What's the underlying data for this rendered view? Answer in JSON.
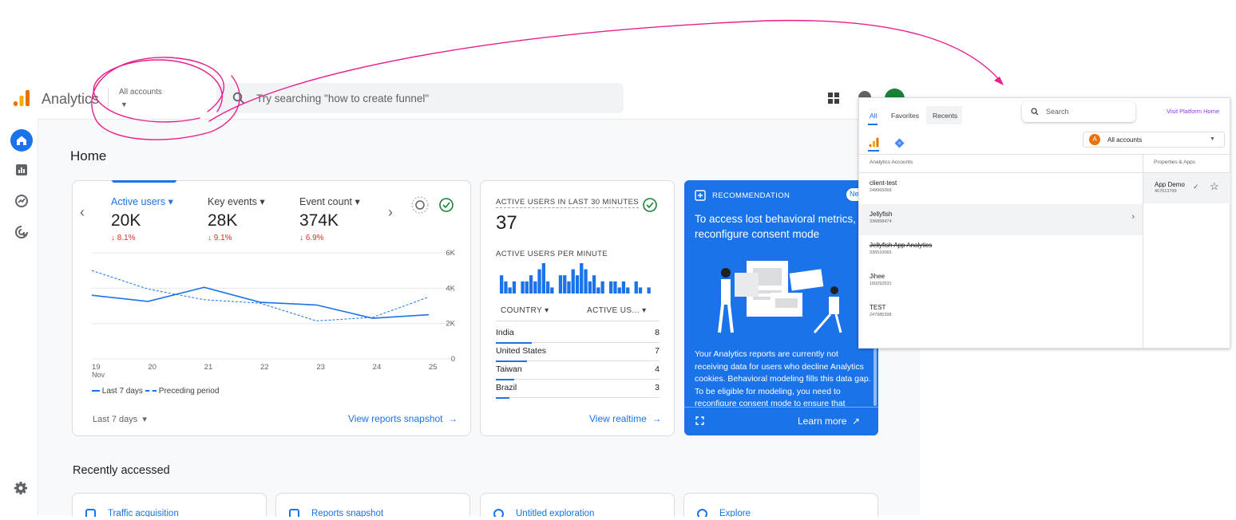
{
  "header": {
    "app_name": "Analytics",
    "account_selector": "All accounts",
    "search_placeholder": "Try searching \"how to create funnel\""
  },
  "home": {
    "title": "Home",
    "metrics": [
      {
        "label": "Active users",
        "value": "20K",
        "delta": "8.1%"
      },
      {
        "label": "Key events",
        "value": "28K",
        "delta": "9.1%"
      },
      {
        "label": "Event count",
        "value": "374K",
        "delta": "6.9%"
      }
    ],
    "chart_data": {
      "type": "line",
      "x": [
        "19",
        "20",
        "21",
        "22",
        "23",
        "24",
        "25"
      ],
      "x_sublabel": "Nov",
      "y_ticks": [
        "6K",
        "4K",
        "2K",
        "0"
      ],
      "ylim": [
        0,
        6000
      ],
      "series": [
        {
          "name": "Last 7 days",
          "values": [
            3600,
            3250,
            4050,
            3200,
            3050,
            2300,
            2500
          ]
        },
        {
          "name": "Preceding period",
          "values": [
            5000,
            3950,
            3350,
            3150,
            2150,
            2350,
            3500
          ]
        }
      ],
      "legend": "bottom-left",
      "grid": true
    },
    "date_range": "Last 7 days",
    "view_snapshot": "View reports snapshot"
  },
  "realtime": {
    "title": "ACTIVE USERS IN LAST 30 MINUTES",
    "value": "37",
    "per_minute_label": "ACTIVE USERS PER MINUTE",
    "bars": [
      3,
      2,
      1,
      2,
      0,
      2,
      2,
      3,
      2,
      4,
      5,
      2,
      1,
      0,
      3,
      3,
      2,
      4,
      3,
      5,
      4,
      2,
      3,
      1,
      2,
      0,
      2,
      2,
      1,
      2,
      1,
      0,
      2,
      1,
      0,
      1,
      0
    ],
    "table_headers": [
      "COUNTRY",
      "ACTIVE US..."
    ],
    "rows": [
      {
        "country": "India",
        "users": "8"
      },
      {
        "country": "United States",
        "users": "7"
      },
      {
        "country": "Taiwan",
        "users": "4"
      },
      {
        "country": "Brazil",
        "users": "3"
      }
    ],
    "link": "View realtime"
  },
  "recommendation": {
    "header": "RECOMMENDATION",
    "badge": "Ne",
    "title": "To access lost behavioral metrics, reconfigure consent mode",
    "body": "Your Analytics reports are currently not receiving data for users who decline Analytics cookies. Behavioral modeling fills this data gap. To be eligible for modeling, you need to reconfigure consent mode to ensure that",
    "learn_more": "Learn more"
  },
  "recently_accessed": {
    "title": "Recently accessed",
    "items": [
      "Traffic acquisition",
      "Reports snapshot",
      "Untitled exploration",
      "Explore"
    ]
  },
  "account_panel": {
    "tabs": [
      "All",
      "Favorites",
      "Recents"
    ],
    "search_placeholder": "Search",
    "visit_link": "Visit Platform Home",
    "account_filter": "All accounts",
    "account_filter_initial": "A",
    "col_accounts": "Analytics Accounts",
    "col_properties": "Properties & Apps",
    "accounts": [
      {
        "name": "client-test",
        "id": "249965068"
      },
      {
        "name": "Jellyfish",
        "id": "336858474"
      },
      {
        "name": "Jellyfish App Analytics",
        "id": "336510065"
      },
      {
        "name": "Jihee",
        "id": "160292531"
      },
      {
        "name": "TEST",
        "id": "247985398"
      }
    ],
    "property": {
      "name": "App Demo",
      "id": "467613799"
    }
  },
  "colors": {
    "brand_blue": "#1a73e8",
    "annotation_pink": "#e91e8c",
    "delta_red": "#d93025"
  }
}
